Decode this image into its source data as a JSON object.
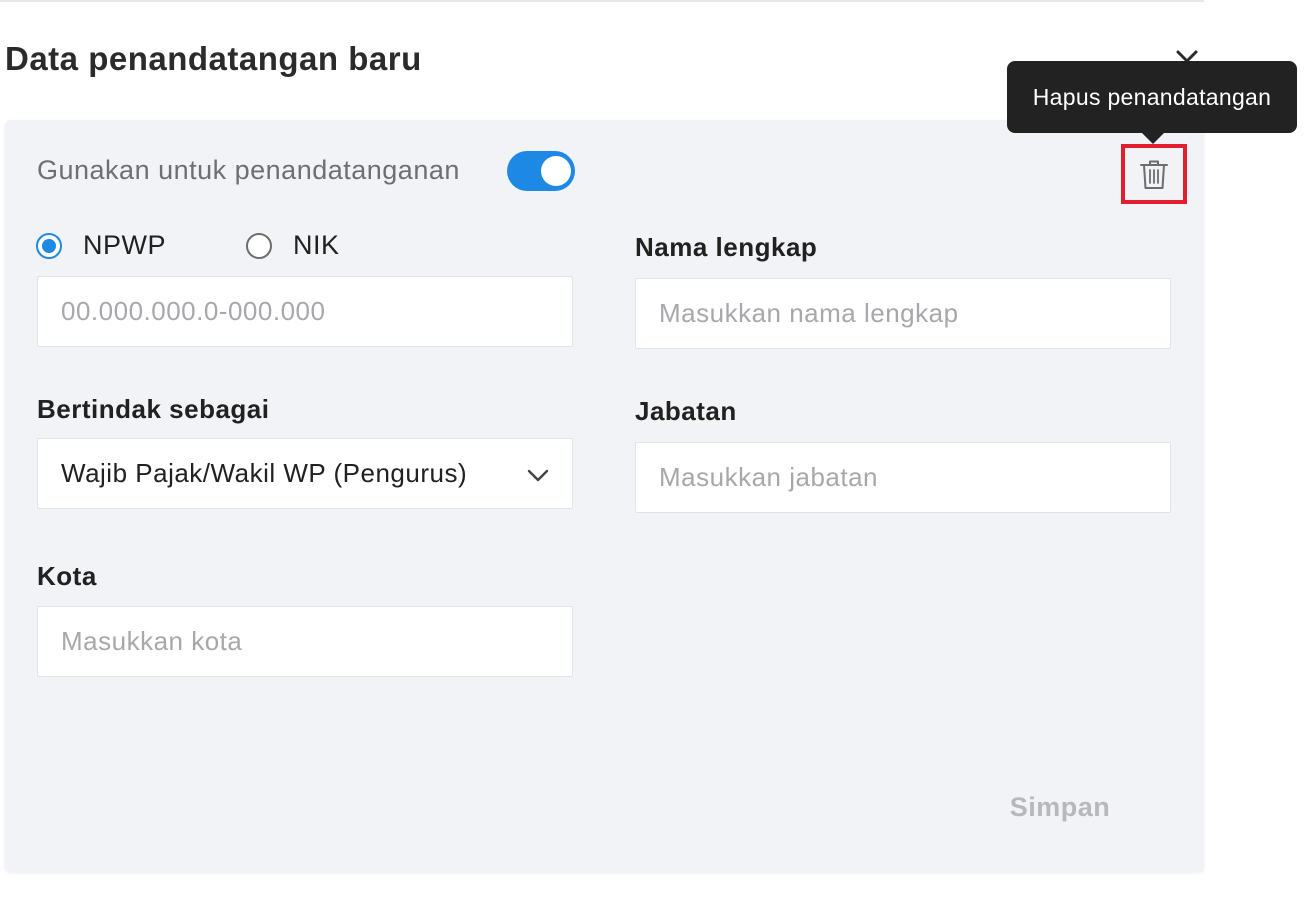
{
  "dialog": {
    "title": "Data penandatangan baru"
  },
  "tooltip": {
    "text": "Hapus penandatangan"
  },
  "signing_toggle": {
    "label": "Gunakan untuk penandatanganan",
    "enabled": true
  },
  "id_type": {
    "options": [
      {
        "label": "NPWP",
        "selected": true
      },
      {
        "label": "NIK",
        "selected": false
      }
    ],
    "input_placeholder": "00.000.000.0-000.000"
  },
  "full_name": {
    "label": "Nama lengkap",
    "placeholder": "Masukkan nama lengkap"
  },
  "acting_as": {
    "label": "Bertindak sebagai",
    "value": "Wajib Pajak/Wakil WP (Pengurus)"
  },
  "position": {
    "label": "Jabatan",
    "placeholder": "Masukkan jabatan"
  },
  "city": {
    "label": "Kota",
    "placeholder": "Masukkan kota"
  },
  "actions": {
    "save_label": "Simpan"
  },
  "colors": {
    "accent": "#1e88e5",
    "highlight": "#e01e2d",
    "panel_bg": "#f2f3f7",
    "tooltip_bg": "#222222"
  },
  "icons": {
    "close": "close-icon",
    "delete": "trash-icon",
    "dropdown": "chevron-down-icon"
  }
}
